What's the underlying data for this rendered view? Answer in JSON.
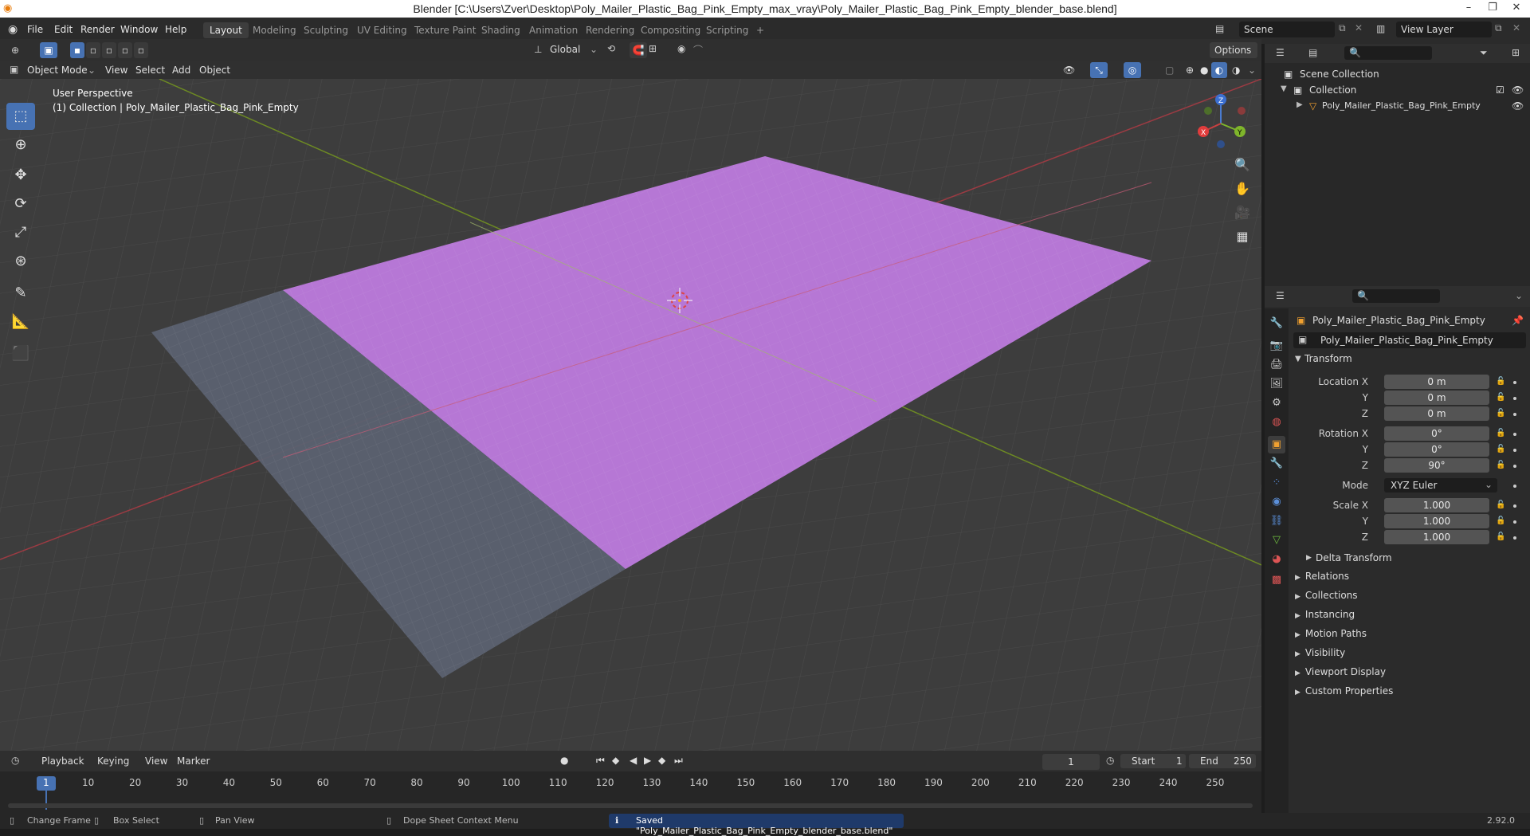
{
  "window": {
    "title": "Blender [C:\\Users\\Zver\\Desktop\\Poly_Mailer_Plastic_Bag_Pink_Empty_max_vray\\Poly_Mailer_Plastic_Bag_Pink_Empty_blender_base.blend]"
  },
  "menu": [
    "File",
    "Edit",
    "Render",
    "Window",
    "Help"
  ],
  "workspaces": [
    "Layout",
    "Modeling",
    "Sculpting",
    "UV Editing",
    "Texture Paint",
    "Shading",
    "Animation",
    "Rendering",
    "Compositing",
    "Scripting",
    "+"
  ],
  "scene": {
    "name": "Scene",
    "view_layer": "View Layer"
  },
  "viewport_header": {
    "mode": "Object Mode",
    "items": [
      "View",
      "Select",
      "Add",
      "Object"
    ],
    "orientation": "Global",
    "options_label": "Options"
  },
  "viewport": {
    "perspective": "User Perspective",
    "collection_info": "(1) Collection | Poly_Mailer_Plastic_Bag_Pink_Empty",
    "gizmo": {
      "x": "X",
      "y": "Y",
      "z": "Z"
    },
    "colors": {
      "bg": "#3d3d3d",
      "pink": "#b876d6",
      "gray_plane": "#5f6470",
      "x_axis": "#c0404a",
      "y_axis": "#7b9a2a"
    }
  },
  "outliner": {
    "root": "Scene Collection",
    "collection": "Collection",
    "object": "Poly_Mailer_Plastic_Bag_Pink_Empty"
  },
  "properties": {
    "object_name": "Poly_Mailer_Plastic_Bag_Pink_Empty",
    "data_name": "Poly_Mailer_Plastic_Bag_Pink_Empty",
    "transform_label": "Transform",
    "location": {
      "label": "Location X",
      "x": "0 m",
      "y": "0 m",
      "z": "0 m"
    },
    "rotation": {
      "label": "Rotation X",
      "x": "0°",
      "y": "0°",
      "z": "90°"
    },
    "mode": {
      "label": "Mode",
      "value": "XYZ Euler"
    },
    "scale": {
      "label": "Scale X",
      "x": "1.000",
      "y": "1.000",
      "z": "1.000"
    },
    "axis_y": "Y",
    "axis_z": "Z",
    "delta_transform": "Delta Transform",
    "sections": [
      "Relations",
      "Collections",
      "Instancing",
      "Motion Paths",
      "Visibility",
      "Viewport Display",
      "Custom Properties"
    ]
  },
  "timeline": {
    "menus": [
      "Playback",
      "Keying",
      "View",
      "Marker"
    ],
    "current_frame": "1",
    "start_label": "Start",
    "start": "1",
    "end_label": "End",
    "end": "250",
    "ticks": [
      "1",
      "10",
      "20",
      "30",
      "40",
      "50",
      "60",
      "70",
      "80",
      "90",
      "100",
      "110",
      "120",
      "130",
      "140",
      "150",
      "160",
      "170",
      "180",
      "190",
      "200",
      "210",
      "220",
      "230",
      "240",
      "250"
    ]
  },
  "statusbar": {
    "change_frame": "Change Frame",
    "box_select": "Box Select",
    "pan_view": "Pan View",
    "context_menu": "Dope Sheet Context Menu",
    "message": "Saved \"Poly_Mailer_Plastic_Bag_Pink_Empty_blender_base.blend\"",
    "version": "2.92.0"
  }
}
